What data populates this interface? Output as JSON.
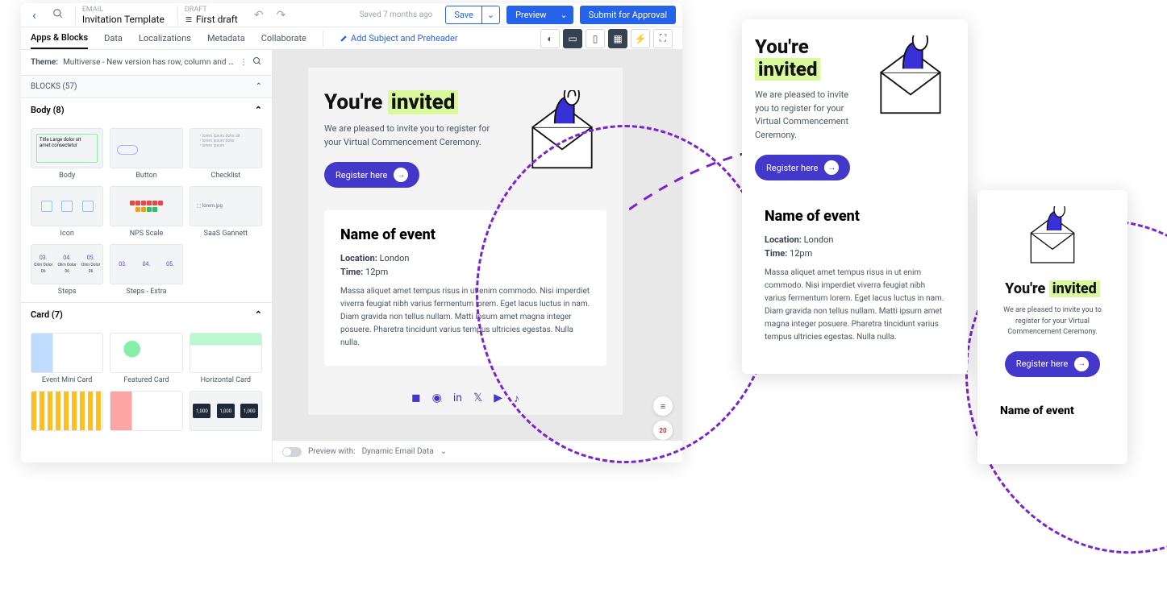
{
  "topbar": {
    "email_label": "EMAIL",
    "email_name": "Invitation Template",
    "draft_label": "DRAFT",
    "draft_name": "First draft",
    "saved": "Saved 7 months ago",
    "save": "Save",
    "preview": "Preview",
    "submit": "Submit for Approval"
  },
  "tabs": {
    "t0": "Apps & Blocks",
    "t1": "Data",
    "t2": "Localizations",
    "t3": "Metadata",
    "t4": "Collaborate",
    "add_subject": "Add Subject and Preheader"
  },
  "sidebar": {
    "theme_label": "Theme:",
    "theme_text": "Multiverse - New version has row, column and img padding styles within the th...",
    "blocks_head": "BLOCKS (57)",
    "body_head": "Body (8)",
    "card_head": "Card (7)",
    "b": {
      "body": "Body",
      "button": "Button",
      "checklist": "Checklist",
      "icon": "Icon",
      "nps": "NPS Scale",
      "saas": "SaaS Gannett",
      "steps": "Steps",
      "steps_extra": "Steps - Extra",
      "evmini": "Event Mini Card",
      "feat": "Featured Card",
      "horiz": "Horizontal Card"
    },
    "steps": {
      "s1": "03.",
      "s1b": "Olim Dolor 06",
      "s2": "04.",
      "s2b": "Olim Dolor 06",
      "s3": "05.",
      "s3b": "Olim Dolor 06"
    },
    "metric": "1,000"
  },
  "email": {
    "title_pre": "You're ",
    "title_hl": "invited",
    "sub": "We are pleased to invite you to register for your Virtual Commencement Ceremony.",
    "cta": "Register here",
    "event_name": "Name of event",
    "loc_label": "Location:",
    "loc_val": " London",
    "time_label": "Time:",
    "time_val": " 12pm",
    "lorem": "Massa aliquet amet tempus risus in ut enim commodo. Nisi imperdiet viverra feugiat nibh varius fermentum lorem. Eget lacus luctus in nam. Diam gravida non tellus nullam. Matti ipsum amet magna integer posuere. Pharetra tincidunt varius tempus ultricies egestas. Nulla nulla."
  },
  "preview_tablet": {
    "lorem": "Massa aliquet amet tempus risus in ut enim commodo. Nisi imperdiet viverra feugiat nibh varius fermentum lorem. Eget lacus luctus in nam. Diam gravida non tellus nullam. Matti ipsum amet magna integer posuere. Pharetra tincidunt varius tempus ultricies egestas. Nulla nulla."
  },
  "bottombar": {
    "label": "Preview with:",
    "val": "Dynamic Email Data"
  },
  "float": {
    "count": "20"
  }
}
